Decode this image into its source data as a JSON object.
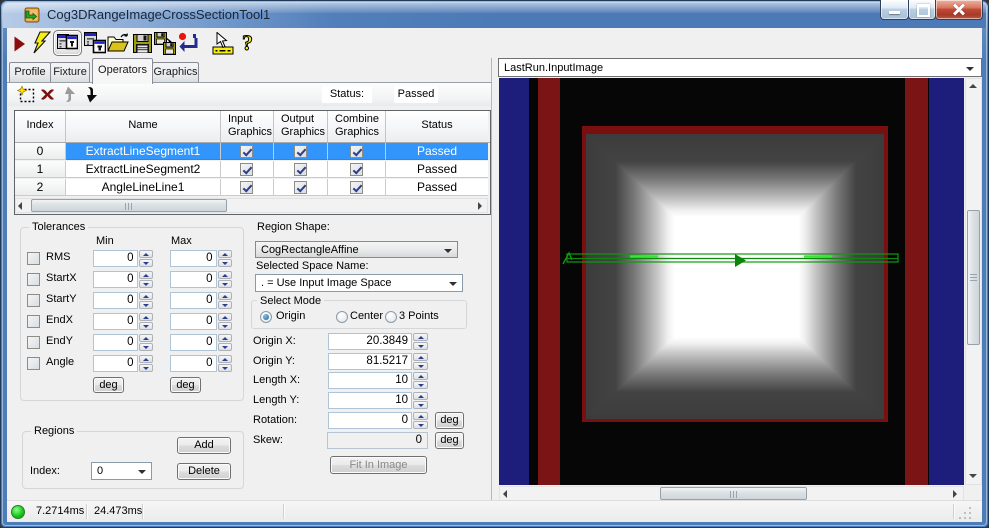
{
  "window": {
    "title": "Cog3DRangeImageCrossSectionTool1",
    "buttons": {
      "minimize": "minimize",
      "maximize": "maximize",
      "close": "close"
    }
  },
  "toolbar": {
    "icons": [
      "run",
      "run-electric",
      "electric-window",
      "float-window",
      "open-file",
      "save-file",
      "save-image",
      "reset",
      "benchmark",
      "help"
    ]
  },
  "tabs": {
    "items": [
      {
        "label": "Profile"
      },
      {
        "label": "Fixture"
      },
      {
        "label": "Operators"
      },
      {
        "label": "Graphics"
      }
    ],
    "active": "Operators"
  },
  "operators": {
    "toolbar_icons": [
      "add-operator",
      "delete-operator",
      "move-up",
      "move-down"
    ],
    "status_label": "Status:",
    "status_value": "Passed",
    "table": {
      "columns": [
        "Index",
        "Name",
        "Input Graphics",
        "Output Graphics",
        "Combine Graphics",
        "Status"
      ],
      "col_header_line1": {
        "input": "Input",
        "output": "Output",
        "combine": "Combine"
      },
      "col_header_line2": {
        "input": "Graphics",
        "output": "Graphics",
        "combine": "Graphics"
      },
      "rows": [
        {
          "index": "0",
          "name": "ExtractLineSegment1",
          "input_graphics": true,
          "output_graphics": true,
          "combine_graphics": true,
          "status": "Passed",
          "selected": true
        },
        {
          "index": "1",
          "name": "ExtractLineSegment2",
          "input_graphics": true,
          "output_graphics": true,
          "combine_graphics": true,
          "status": "Passed",
          "selected": false
        },
        {
          "index": "2",
          "name": "AngleLineLine1",
          "input_graphics": true,
          "output_graphics": true,
          "combine_graphics": true,
          "status": "Passed",
          "selected": false
        }
      ]
    }
  },
  "tolerances": {
    "title": "Tolerances",
    "min_header": "Min",
    "max_header": "Max",
    "deg_label": "deg",
    "rows": [
      {
        "label": "RMS",
        "checked": false,
        "min": "0",
        "max": "0"
      },
      {
        "label": "StartX",
        "checked": false,
        "min": "0",
        "max": "0"
      },
      {
        "label": "StartY",
        "checked": false,
        "min": "0",
        "max": "0"
      },
      {
        "label": "EndX",
        "checked": false,
        "min": "0",
        "max": "0"
      },
      {
        "label": "EndY",
        "checked": false,
        "min": "0",
        "max": "0"
      },
      {
        "label": "Angle",
        "checked": false,
        "min": "0",
        "max": "0"
      }
    ]
  },
  "regions": {
    "title": "Regions",
    "add_label": "Add",
    "delete_label": "Delete",
    "index_label": "Index:",
    "index_value": "0"
  },
  "region_shape": {
    "label": "Region Shape:",
    "value": "CogRectangleAffine"
  },
  "space_name": {
    "label": "Selected Space Name:",
    "value": ". = Use Input Image Space"
  },
  "select_mode": {
    "title": "Select Mode",
    "options": [
      {
        "label": "Origin",
        "selected": true
      },
      {
        "label": "Center",
        "selected": false
      },
      {
        "label": "3 Points",
        "selected": false
      }
    ]
  },
  "shape_fields": {
    "rows": [
      {
        "label": "Origin X:",
        "value": "20.3849",
        "has_spin": true,
        "has_deg": false,
        "disabled": false
      },
      {
        "label": "Origin Y:",
        "value": "81.5217",
        "has_spin": true,
        "has_deg": false,
        "disabled": false
      },
      {
        "label": "Length X:",
        "value": "10",
        "has_spin": true,
        "has_deg": false,
        "disabled": false
      },
      {
        "label": "Length Y:",
        "value": "10",
        "has_spin": true,
        "has_deg": false,
        "disabled": false
      },
      {
        "label": "Rotation:",
        "value": "0",
        "has_spin": true,
        "has_deg": true,
        "disabled": false
      },
      {
        "label": "Skew:",
        "value": "0",
        "has_spin": false,
        "has_deg": true,
        "disabled": true
      }
    ],
    "deg_label": "deg",
    "fit_button_label": "Fit In Image"
  },
  "display": {
    "source_combo_value": "LastRun.InputImage"
  },
  "statusbar": {
    "run_time": "7.2714ms",
    "total_time": "24.473ms"
  }
}
